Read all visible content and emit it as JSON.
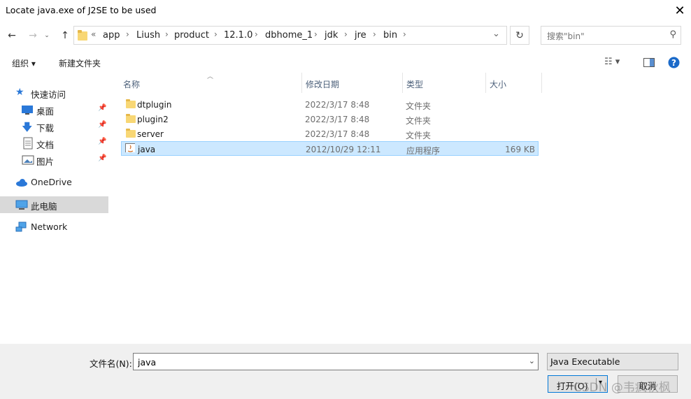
{
  "window": {
    "title": "Locate java.exe of J2SE to be used"
  },
  "nav": {
    "crumbs": [
      "app",
      "Liush",
      "product",
      "12.1.0",
      "dbhome_1",
      "jdk",
      "jre",
      "bin"
    ],
    "overflow": "«",
    "search_placeholder": "搜索\"bin\""
  },
  "toolbar": {
    "organize": "组织 ▾",
    "new_folder": "新建文件夹"
  },
  "sidebar": {
    "quick_access": "快速访问",
    "items": [
      "桌面",
      "下载",
      "文档",
      "图片"
    ],
    "onedrive": "OneDrive",
    "this_pc": "此电脑",
    "network": "Network"
  },
  "columns": {
    "name": "名称",
    "date": "修改日期",
    "type": "类型",
    "size": "大小"
  },
  "files": [
    {
      "name": "dtplugin",
      "date": "2022/3/17 8:48",
      "type": "文件夹",
      "size": ""
    },
    {
      "name": "plugin2",
      "date": "2022/3/17 8:48",
      "type": "文件夹",
      "size": ""
    },
    {
      "name": "server",
      "date": "2022/3/17 8:48",
      "type": "文件夹",
      "size": ""
    },
    {
      "name": "java",
      "date": "2012/10/29 12:11",
      "type": "应用程序",
      "size": "169 KB"
    }
  ],
  "bottom": {
    "filename_label": "文件名(N):",
    "filename_value": "java",
    "filetype": "Java Executable",
    "open": "打开(O)",
    "cancel": "取消"
  },
  "watermark": "CSDN @韦疯秋枫",
  "colors": {
    "selection": "#cce8ff",
    "selection_border": "#99d1ff",
    "accent": "#0078d7",
    "folder": "#f8d775"
  }
}
